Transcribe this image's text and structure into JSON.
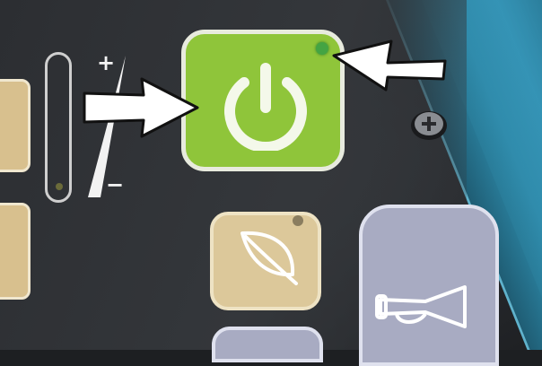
{
  "panel": {
    "level_control": {
      "plus_label": "+",
      "minus_label": "−"
    },
    "buttons": {
      "power": {
        "icon": "power-icon",
        "color": "#8fc53a",
        "led_color": "#44a443"
      },
      "eco": {
        "icon": "leaf-icon",
        "color": "#dcc89a",
        "led_color": "#8a7d5f"
      },
      "horn": {
        "icon": "horn-icon",
        "color": "#a8abc2"
      }
    },
    "callouts": [
      {
        "icon": "arrow-icon",
        "points_to": "power-button"
      },
      {
        "icon": "arrow-icon",
        "points_to": "power-led"
      }
    ]
  }
}
